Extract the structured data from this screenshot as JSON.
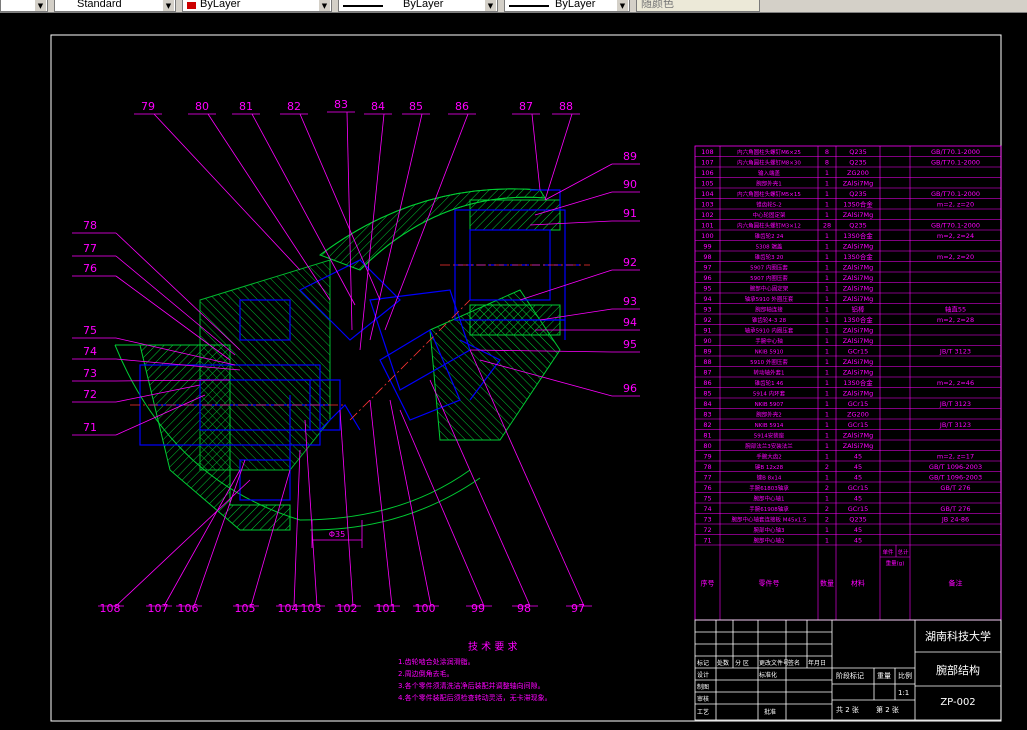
{
  "toolbar": {
    "text_style": "Standard",
    "layer_color": "ByLayer",
    "linetype": "ByLayer",
    "lineweight": "ByLayer",
    "plot_style": "随颜色",
    "swatch_color": "#cc0000"
  },
  "colors": {
    "frame": "#ffffff",
    "leader": "#ff00ff",
    "part_blue": "#0000ff",
    "hatch_green": "#00cc33",
    "table": "#ff00ff"
  },
  "callouts_top": [
    "79",
    "80",
    "81",
    "82",
    "83",
    "84",
    "85",
    "86",
    "87",
    "88"
  ],
  "callouts_right": [
    "89",
    "90",
    "91",
    "92",
    "93",
    "94",
    "95",
    "96"
  ],
  "callouts_left": [
    "78",
    "77",
    "76",
    "75",
    "74",
    "73",
    "72",
    "71"
  ],
  "callouts_bottom": [
    "108",
    "107",
    "106",
    "105",
    "104",
    "103",
    "102",
    "101",
    "100",
    "99",
    "98",
    "97"
  ],
  "dimension": "Φ35",
  "tech_req": {
    "title": "技 术 要 求",
    "items": [
      "1.齿轮啮合处涂润滑脂。",
      "2.周边倒角去毛。",
      "3.各个零件须清洗洁净后装配并调整轴向间隙。",
      "4.各个零件装配后须检查转动灵活，无卡滞现象。"
    ]
  },
  "bom": [
    [
      "108",
      "内六角圆柱头螺钉M6×25",
      "8",
      "Q235",
      "GB/T70.1-2000"
    ],
    [
      "107",
      "内六角圆柱头螺钉M8×30",
      "8",
      "Q235",
      "GB/T70.1-2000"
    ],
    [
      "106",
      "输入端盖",
      "1",
      "ZG200",
      ""
    ],
    [
      "105",
      "腕部外壳1",
      "1",
      "ZAlSi7Mg",
      ""
    ],
    [
      "104",
      "内六角圆柱头螺钉M5×15",
      "1",
      "Q235",
      "GB/T70.1-2000"
    ],
    [
      "103",
      "锥齿轮5-2",
      "1",
      "13S0合金",
      "m=2, z=20"
    ],
    [
      "102",
      "中心轮固定架",
      "1",
      "ZAlSi7Mg",
      ""
    ],
    [
      "101",
      "内六角圆柱头螺钉M3×12",
      "28",
      "Q235",
      "GB/T70.1-2000"
    ],
    [
      "100",
      "锥齿轮2 24",
      "1",
      "13S0合金",
      "m=2, z=24"
    ],
    [
      "99",
      "5308 端盖",
      "1",
      "ZAlSi7Mg",
      ""
    ],
    [
      "98",
      "锥齿轮3 20",
      "1",
      "13S0合金",
      "m=2, z=20"
    ],
    [
      "97",
      "5907 内圈压套",
      "1",
      "ZAlSi7Mg",
      ""
    ],
    [
      "96",
      "5907 内圈压套",
      "1",
      "ZAlSi7Mg",
      ""
    ],
    [
      "95",
      "腕部中心固定架",
      "1",
      "ZAlSi7Mg",
      ""
    ],
    [
      "94",
      "轴承5910 外圈压套",
      "1",
      "ZAlSi7Mg",
      ""
    ],
    [
      "93",
      "腕部轴连接",
      "1",
      "铝棒",
      "轴直55"
    ],
    [
      "92",
      "锥齿轮4-3 28",
      "1",
      "13S0合金",
      "m=2, z=28"
    ],
    [
      "91",
      "轴承5910 内圈压套",
      "1",
      "ZAlSi7Mg",
      ""
    ],
    [
      "90",
      "手腕中心轴",
      "1",
      "ZAlSi7Mg",
      ""
    ],
    [
      "89",
      "NKIB 5910",
      "1",
      "GCr15",
      "JB/T 3123"
    ],
    [
      "88",
      "5910 外圈压套",
      "1",
      "ZAlSi7Mg",
      ""
    ],
    [
      "87",
      "转动轴外套1",
      "1",
      "ZAlSi7Mg",
      ""
    ],
    [
      "86",
      "锥齿轮1 46",
      "1",
      "13S0合金",
      "m=2, z=46"
    ],
    [
      "85",
      "5914 内环套",
      "1",
      "ZAlSi7Mg",
      ""
    ],
    [
      "84",
      "NKIB 5907",
      "1",
      "GCr15",
      "JB/T 3123"
    ],
    [
      "83",
      "腕部外壳2",
      "1",
      "ZG200",
      ""
    ],
    [
      "82",
      "NKIB 5914",
      "1",
      "GCr15",
      "JB/T 3123"
    ],
    [
      "81",
      "5914安装座",
      "1",
      "ZAlSi7Mg",
      ""
    ],
    [
      "80",
      "腕部法兰3安装法兰",
      "1",
      "ZAlSi7Mg",
      ""
    ],
    [
      "79",
      "手腕大齿2",
      "1",
      "45",
      "m=2, z=17"
    ],
    [
      "78",
      "键B 12x28",
      "2",
      "45",
      "GB/T 1096-2003"
    ],
    [
      "77",
      "键B 8x14",
      "1",
      "45",
      "GB/T 1096-2003"
    ],
    [
      "76",
      "手腕61803轴承",
      "2",
      "GCr15",
      "GB/T 276"
    ],
    [
      "75",
      "腕部中心轴1",
      "1",
      "45",
      ""
    ],
    [
      "74",
      "手腕61908轴承",
      "2",
      "GCr15",
      "GB/T 276"
    ],
    [
      "73",
      "腕部中心轴套连接板 M45x1.5",
      "2",
      "Q235",
      "JB 24-86"
    ],
    [
      "72",
      "腕部中心轴3",
      "1",
      "45",
      ""
    ],
    [
      "71",
      "腕部中心轴2",
      "1",
      "45",
      ""
    ]
  ],
  "bom_header": {
    "no": "序号",
    "name": "零件号",
    "qty": "数量",
    "material": "材料",
    "weight_single": "单件",
    "weight_total": "总计",
    "weight": "重量(g)",
    "remark": "备注"
  },
  "title_block": {
    "school": "湖南科技大学",
    "drawing_name": "腕部结构",
    "drawing_no": "ZP-002",
    "scale_label": "比例",
    "scale": "1:1",
    "weight_label": "重量",
    "stage_label": "阶段标记",
    "sheets_total": "共 2 张",
    "sheet_no": "第 2 张",
    "rev_row": [
      "标记",
      "处数",
      "分 区",
      "更改文件号",
      "签名",
      "年月日"
    ],
    "design": "设计",
    "design_std": "标准化",
    "draw": "制图",
    "review": "审核",
    "craft": "工艺",
    "approve": "批准"
  }
}
